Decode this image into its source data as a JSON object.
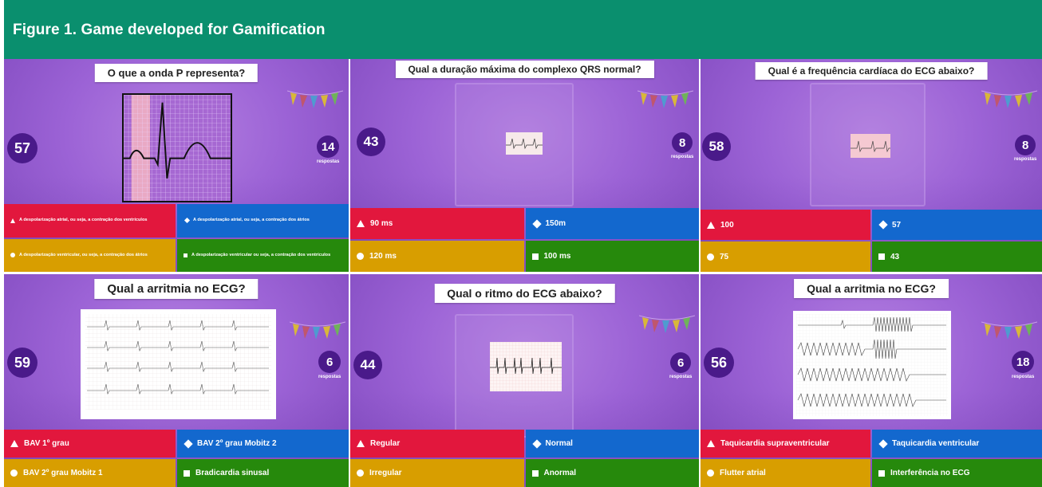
{
  "figure": {
    "title": "Figure 1. Game developed for Gamification"
  },
  "colors": {
    "header": "#0a8f6e",
    "red": "#e2173d",
    "blue": "#1368ce",
    "yellow": "#d89e00",
    "green": "#26890c",
    "counter": "#4a1a8a"
  },
  "panels": [
    {
      "question": "O que a onda P representa?",
      "timer": "57",
      "answers_count": "14",
      "answers_label": "respostas",
      "image": "ecg-waveform-diagram",
      "options": [
        {
          "icon": "triangle-icon",
          "text": "A despolarização atrial, ou seja, a contração dos ventrículos"
        },
        {
          "icon": "diamond-icon",
          "text": "A despolarização atrial, ou seja, a contração dos átrios"
        },
        {
          "icon": "circle-icon",
          "text": "A despolarização ventricular, ou seja, a contração dos átrios"
        },
        {
          "icon": "square-icon",
          "text": "A despolarização ventricular ou seja, a contração dos ventrículos"
        }
      ]
    },
    {
      "question": "Qual a duração máxima do complexo QRS normal?",
      "timer": "43",
      "answers_count": "8",
      "answers_label": "respostas",
      "image": "ecg-strip-small",
      "options": [
        {
          "icon": "triangle-icon",
          "text": "90 ms"
        },
        {
          "icon": "diamond-icon",
          "text": "150m"
        },
        {
          "icon": "circle-icon",
          "text": "120 ms"
        },
        {
          "icon": "square-icon",
          "text": "100 ms"
        }
      ]
    },
    {
      "question": "Qual é a frequência cardíaca do ECG abaixo?",
      "timer": "58",
      "answers_count": "8",
      "answers_label": "respostas",
      "image": "ecg-strip-small",
      "options": [
        {
          "icon": "triangle-icon",
          "text": "100"
        },
        {
          "icon": "diamond-icon",
          "text": "57"
        },
        {
          "icon": "circle-icon",
          "text": "75"
        },
        {
          "icon": "square-icon",
          "text": "43"
        }
      ]
    },
    {
      "question": "Qual a arritmia no ECG?",
      "timer": "59",
      "answers_count": "6",
      "answers_label": "respostas",
      "image": "ecg-12-lead",
      "options": [
        {
          "icon": "triangle-icon",
          "text": "BAV 1º grau"
        },
        {
          "icon": "diamond-icon",
          "text": "BAV 2º grau Mobitz 2"
        },
        {
          "icon": "circle-icon",
          "text": "BAV 2º grau Mobitz 1"
        },
        {
          "icon": "square-icon",
          "text": "Bradicardia sinusal"
        }
      ]
    },
    {
      "question": "Qual o ritmo do ECG abaixo?",
      "timer": "44",
      "answers_count": "6",
      "answers_label": "respostas",
      "image": "ecg-rhythm-strip",
      "options": [
        {
          "icon": "triangle-icon",
          "text": "Regular"
        },
        {
          "icon": "diamond-icon",
          "text": "Normal"
        },
        {
          "icon": "circle-icon",
          "text": "Irregular"
        },
        {
          "icon": "square-icon",
          "text": "Anormal"
        }
      ]
    },
    {
      "question": "Qual a arritmia no ECG?",
      "timer": "56",
      "answers_count": "18",
      "answers_label": "respostas",
      "image": "ecg-tachy-strip",
      "options": [
        {
          "icon": "triangle-icon",
          "text": "Taquicardia supraventricular"
        },
        {
          "icon": "diamond-icon",
          "text": "Taquicardia ventricular"
        },
        {
          "icon": "circle-icon",
          "text": "Flutter atrial"
        },
        {
          "icon": "square-icon",
          "text": "Interferência no ECG"
        }
      ]
    }
  ]
}
